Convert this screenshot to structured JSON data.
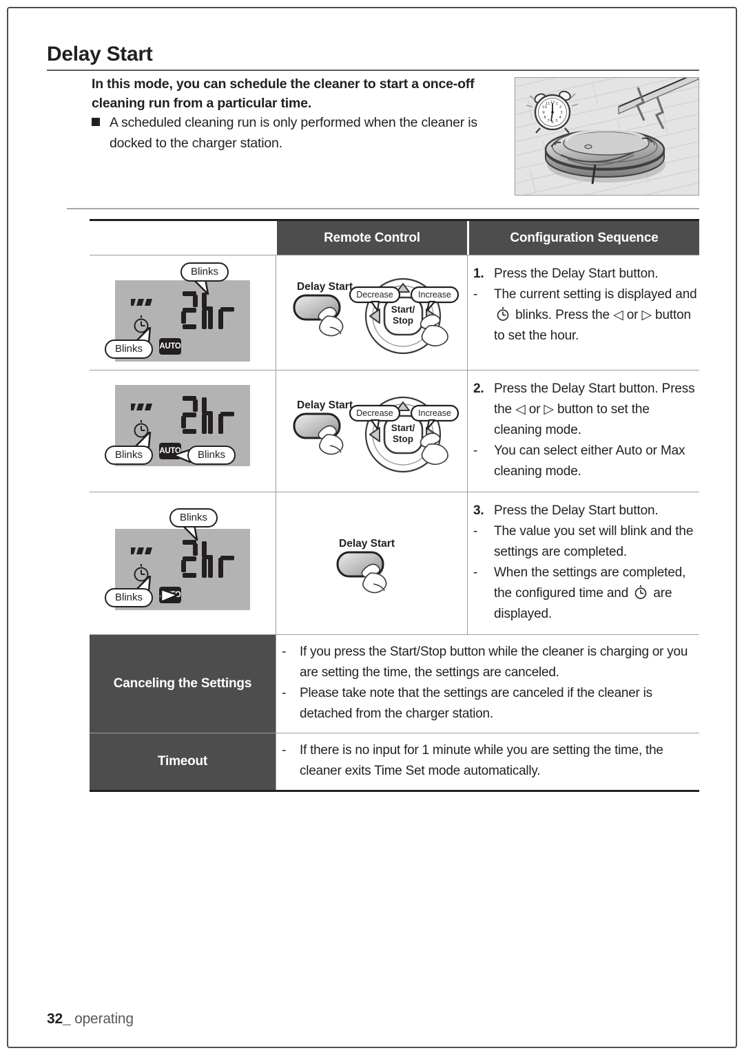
{
  "page": {
    "title": "Delay Start",
    "footer_number": "32",
    "footer_sep": "_",
    "footer_section": "operating"
  },
  "intro": {
    "bold_text": "In this mode, you can schedule the cleaner to start a once-off cleaning run from a particular time.",
    "bullet": "A scheduled cleaning run is only performed when the cleaner is docked to the charger station."
  },
  "illustration": {
    "name": "robot-cleaner-scheduled-start-illustration",
    "alt": "Robot vacuum cleaner on wood floor with alarm clock and signal waves"
  },
  "table": {
    "headers": {
      "blank": "",
      "remote_control": "Remote Control",
      "configuration_sequence": "Configuration Sequence"
    },
    "rows": [
      {
        "lcd": {
          "time": "2hr",
          "auto_badge": "AUTO",
          "callouts": [
            {
              "label": "Blinks",
              "target": "time-display"
            },
            {
              "label": "Blinks",
              "target": "clock-icon"
            }
          ]
        },
        "remote": {
          "delay_start_label": "Delay Start",
          "center_label": "Start/\nStop",
          "center_line1": "Start/",
          "center_line2": "Stop",
          "decrease_label": "Decrease",
          "increase_label": "Increase",
          "show_dpad": true
        },
        "steps": [
          {
            "marker": "1.",
            "bold": true,
            "text": "Press the Delay Start button."
          },
          {
            "marker": "-",
            "bold": false,
            "text": "The current setting is displayed and ⊙ blinks. Press the ◁ or ▷ button to set the hour."
          }
        ]
      },
      {
        "lcd": {
          "time": "2hr",
          "auto_badge": "AUTO",
          "callouts": [
            {
              "label": "Blinks",
              "target": "clock-icon"
            },
            {
              "label": "Blinks",
              "target": "auto-badge"
            }
          ]
        },
        "remote": {
          "delay_start_label": "Delay Start",
          "center_line1": "Start/",
          "center_line2": "Stop",
          "decrease_label": "Decrease",
          "increase_label": "Increase",
          "show_dpad": true
        },
        "steps": [
          {
            "marker": "2.",
            "bold": true,
            "text": "Press the Delay Start button. Press the ◁ or ▷ button to set the cleaning mode."
          },
          {
            "marker": "-",
            "bold": false,
            "text": "You can select either Auto or Max cleaning mode."
          }
        ]
      },
      {
        "lcd": {
          "time": "2hr",
          "auto_badge": "AUTO",
          "callouts": [
            {
              "label": "Blinks",
              "target": "time-display"
            },
            {
              "label": "Blinks",
              "target": "clock-and-auto"
            }
          ]
        },
        "remote": {
          "delay_start_label": "Delay Start",
          "show_dpad": false
        },
        "steps": [
          {
            "marker": "3.",
            "bold": true,
            "text": "Press the Delay Start button."
          },
          {
            "marker": "-",
            "bold": false,
            "text": "The value you set will blink and the settings are completed."
          },
          {
            "marker": "-",
            "bold": false,
            "text": "When the settings are completed, the configured time and ⊙ are displayed."
          }
        ]
      }
    ],
    "notes": [
      {
        "label": "Canceling the Settings",
        "items": [
          "If you press the Start/Stop button while the cleaner is charging or you are setting the time, the settings are canceled.",
          "Please take note that the settings are canceled if the cleaner is detached from the charger station."
        ]
      },
      {
        "label": "Timeout",
        "items": [
          "If there is no input for 1 minute while you are setting the time, the cleaner exits Time Set mode automatically."
        ]
      }
    ]
  },
  "colors": {
    "header_bg": "#4d4d4d",
    "lcd_bg": "#b3b3b3",
    "text": "#231f20",
    "rule": "#9d9d9d"
  }
}
